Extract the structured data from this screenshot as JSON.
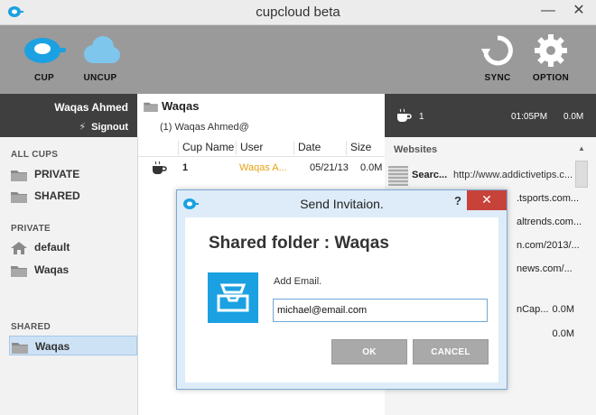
{
  "window": {
    "title": "cupcloud beta",
    "minimize_glyph": "—",
    "close_glyph": "✕"
  },
  "toolbar": {
    "cup_label": "CUP",
    "uncup_label": "UNCUP",
    "sync_label": "SYNC",
    "option_label": "OPTION"
  },
  "user": {
    "name": "Waqas Ahmed",
    "signout_label": "Signout"
  },
  "sidebar": {
    "all_cups_heading": "ALL CUPS",
    "all_cups": [
      {
        "label": "PRIVATE",
        "icon": "folder-icon"
      },
      {
        "label": "SHARED",
        "icon": "folder-icon"
      }
    ],
    "private_heading": "PRIVATE",
    "private": [
      {
        "label": "default",
        "icon": "home-icon"
      },
      {
        "label": "Waqas",
        "icon": "folder-icon"
      }
    ],
    "shared_heading": "SHARED",
    "shared": [
      {
        "label": "Waqas",
        "icon": "folder-icon",
        "selected": true
      }
    ]
  },
  "folder": {
    "title": "Waqas",
    "subtitle": "(1) Waqas Ahmed@",
    "columns": [
      "Cup Name",
      "User",
      "Date",
      "Size"
    ],
    "rows": [
      {
        "cup_name": "1",
        "user": "Waqas A...",
        "date": "05/21/13",
        "size": "0.0M"
      }
    ]
  },
  "activity": {
    "count": "1",
    "time": "01:05PM",
    "size": "0.0M",
    "websites_heading": "Websites",
    "websites": [
      {
        "name": "Searc...",
        "url": "http://www.addictivetips.c..."
      }
    ],
    "partial_urls": [
      ".tsports.com...",
      "altrends.com...",
      "n.com/2013/...",
      "news.com/..."
    ],
    "partial_items": [
      {
        "fragment": "nCap...",
        "size": "0.0M"
      },
      {
        "fragment": "",
        "size": "0.0M"
      }
    ]
  },
  "dialog": {
    "title": "Send Invitaion.",
    "help_glyph": "?",
    "close_glyph": "✕",
    "heading": "Shared folder : Waqas",
    "email_label": "Add Email.",
    "email_value": "michael@email.com",
    "ok_label": "OK",
    "cancel_label": "CANCEL"
  },
  "colors": {
    "accent": "#1ba1e2",
    "toolbar_bg": "#9a9a9a",
    "dark_bar": "#3f3f3f",
    "user_link": "#e8a317",
    "close_red": "#c7433a"
  }
}
